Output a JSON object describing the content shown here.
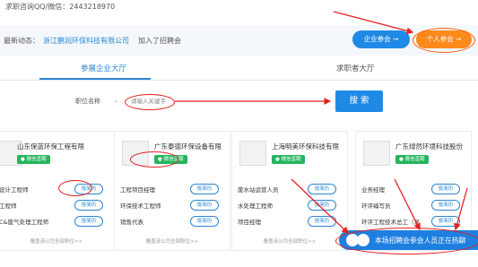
{
  "header": {
    "contact": "求职咨询QQ/微信：2443218970"
  },
  "news": {
    "label": "最新动态：",
    "company": "浙江鹏润环保科技有限公司",
    "action": "加入了招聘会"
  },
  "buttons": {
    "company_join": "企业参会 →",
    "personal_join": "个人参会 →"
  },
  "tabs": [
    {
      "label": "参展企业大厅",
      "active": true
    },
    {
      "label": "求职者大厅",
      "active": false
    }
  ],
  "search": {
    "select_value": "职位名称",
    "placeholder": "请输入关键字",
    "button": "搜 索"
  },
  "cards": [
    {
      "name": "山东保蓝环保工程有限",
      "wechat": "微信直聘",
      "jobs": [
        {
          "title": "设计工程师",
          "btn": "投简历"
        },
        {
          "title": "工程师",
          "btn": "投简历"
        },
        {
          "title": "C&废气处理工程师",
          "btn": "投简历"
        }
      ],
      "footer": "覆盖该公司全部职位>>"
    },
    {
      "name": "广东泰德环保设备有限",
      "wechat": "微信直聘",
      "jobs": [
        {
          "title": "工程项目经理",
          "btn": "投简历"
        },
        {
          "title": "环保技术工程师",
          "btn": "投简历"
        },
        {
          "title": "销售代表",
          "btn": "投简历"
        }
      ],
      "footer": "覆盖该公司全部职位>>"
    },
    {
      "name": "上海明美环保科技有限",
      "wechat": "微信直聘",
      "jobs": [
        {
          "title": "废水站运营人员",
          "btn": "投简历"
        },
        {
          "title": "水处理工程师",
          "btn": "投简历"
        },
        {
          "title": "项目经理",
          "btn": "投简历"
        }
      ],
      "footer": "覆盖该公司全部职位>>"
    },
    {
      "name": "广东绿然环境科技股份",
      "wechat": "微信直聘",
      "jobs": [
        {
          "title": "业务经理",
          "btn": "投简历"
        },
        {
          "title": "环评编写员",
          "btn": "投简历"
        },
        {
          "title": "环评工程技术总工（易",
          "btn": "投简历"
        }
      ],
      "footer": ""
    }
  ],
  "chat": {
    "text": "本场招聘会参会人员正在热聊"
  },
  "colors": {
    "accent_blue": "#1f8ae6",
    "accent_orange": "#ff8a1c",
    "annotation_red": "#e52222",
    "wechat_green": "#23b55e"
  }
}
